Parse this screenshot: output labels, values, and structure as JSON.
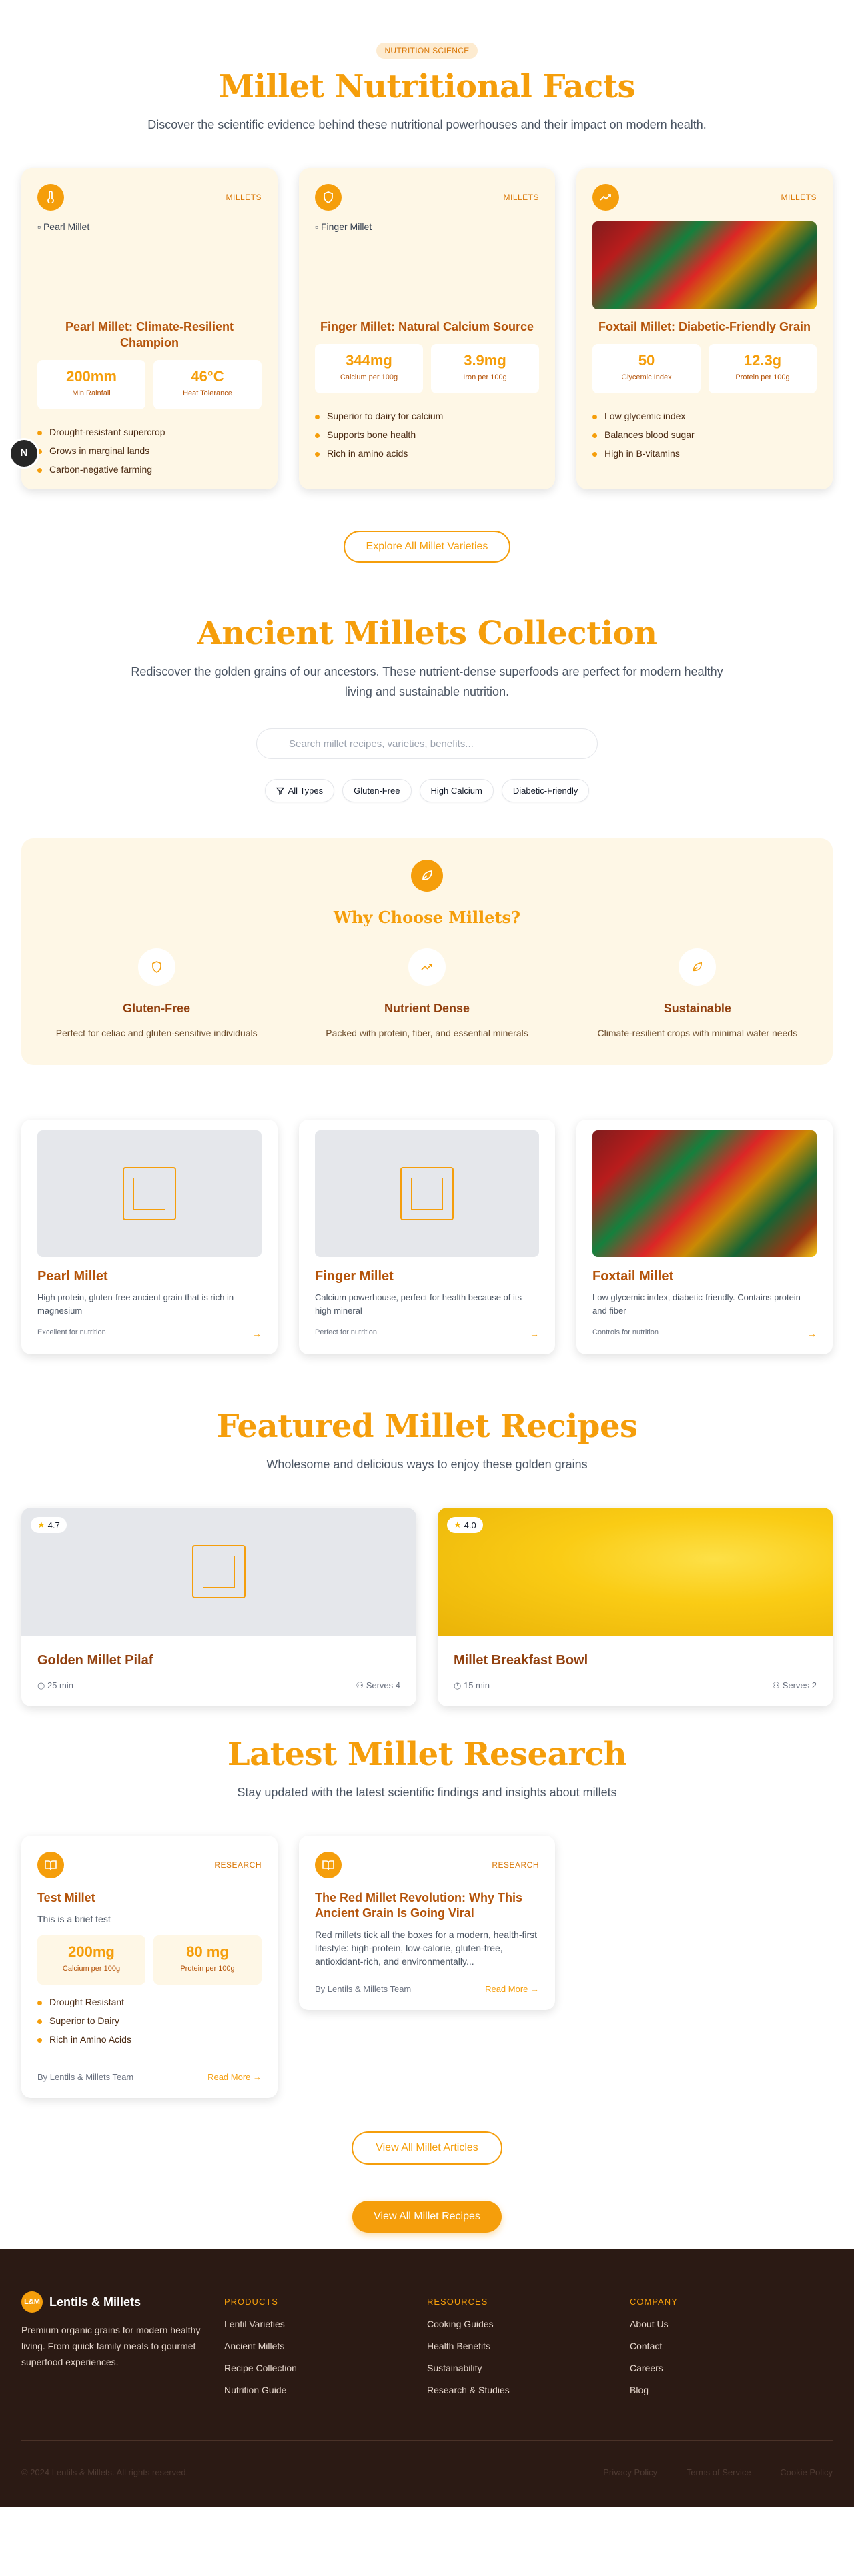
{
  "facts_section": {
    "badge": "NUTRITION SCIENCE",
    "title": "Millet Nutritional Facts",
    "subtitle": "Discover the scientific evidence behind these nutritional powerhouses and their impact on modern health.",
    "cards": [
      {
        "icon": "thermometer-icon",
        "tag": "MILLETS",
        "image_alt": "Pearl Millet",
        "title": "Pearl Millet: Climate-Resilient Champion",
        "stats": [
          {
            "value": "200mm",
            "label": "Min Rainfall"
          },
          {
            "value": "46°C",
            "label": "Heat Tolerance"
          }
        ],
        "points": [
          "Drought-resistant supercrop",
          "Grows in marginal lands",
          "Carbon-negative farming"
        ]
      },
      {
        "icon": "shield-icon",
        "tag": "MILLETS",
        "image_alt": "Finger Millet",
        "title": "Finger Millet: Natural Calcium Source",
        "stats": [
          {
            "value": "344mg",
            "label": "Calcium per 100g"
          },
          {
            "value": "3.9mg",
            "label": "Iron per 100g"
          }
        ],
        "points": [
          "Superior to dairy for calcium",
          "Supports bone health",
          "Rich in amino acids"
        ]
      },
      {
        "icon": "trending-up-icon",
        "tag": "MILLETS",
        "image_alt": "Foxtail Millet",
        "title": "Foxtail Millet: Diabetic-Friendly Grain",
        "stats": [
          {
            "value": "50",
            "label": "Glycemic Index"
          },
          {
            "value": "12.3g",
            "label": "Protein per 100g"
          }
        ],
        "points": [
          "Low glycemic index",
          "Balances blood sugar",
          "High in B-vitamins"
        ]
      }
    ],
    "button": "Explore All Millet Varieties"
  },
  "avatar_letter": "N",
  "collection_section": {
    "title": "Ancient Millets Collection",
    "subtitle": "Rediscover the golden grains of our ancestors. These nutrient-dense superfoods are perfect for modern healthy living and sustainable nutrition.",
    "search_placeholder": "Search millet recipes, varieties, benefits...",
    "filters": [
      "All Types",
      "Gluten-Free",
      "High Calcium",
      "Diabetic-Friendly"
    ],
    "why": {
      "title": "Why Choose Millets?",
      "items": [
        {
          "icon": "shield-icon",
          "title": "Gluten-Free",
          "text": "Perfect for celiac and gluten-sensitive individuals"
        },
        {
          "icon": "trending-up-icon",
          "title": "Nutrient Dense",
          "text": "Packed with protein, fiber, and essential minerals"
        },
        {
          "icon": "leaf-icon",
          "title": "Sustainable",
          "text": "Climate-resilient crops with minimal water needs"
        }
      ]
    },
    "varieties": [
      {
        "name": "Pearl Millet",
        "desc": "High protein, gluten-free ancient grain that is rich in magnesium",
        "note": "Excellent for nutrition"
      },
      {
        "name": "Finger Millet",
        "desc": "Calcium powerhouse, perfect for health because of its high mineral",
        "note": "Perfect for nutrition"
      },
      {
        "name": "Foxtail Millet",
        "desc": "Low glycemic index, diabetic-friendly. Contains protein and fiber",
        "note": "Controls for nutrition"
      }
    ]
  },
  "recipes_section": {
    "title": "Featured Millet Recipes",
    "subtitle": "Wholesome and delicious ways to enjoy these golden grains",
    "recipes": [
      {
        "rating": "4.7",
        "name": "Golden Millet Pilaf",
        "time": "25 min",
        "serves": "Serves 4"
      },
      {
        "rating": "4.0",
        "name": "Millet Breakfast Bowl",
        "time": "15 min",
        "serves": "Serves 2"
      }
    ]
  },
  "research_section": {
    "title": "Latest Millet Research",
    "subtitle": "Stay updated with the latest scientific findings and insights about millets",
    "articles": [
      {
        "tag": "RESEARCH",
        "title": "Test Millet",
        "desc": "This is a brief test",
        "stats": [
          {
            "value": "200mg",
            "label": "Calcium per 100g"
          },
          {
            "value": "80 mg",
            "label": "Protein per 100g"
          }
        ],
        "points": [
          "Drought Resistant",
          "Superior to Dairy",
          "Rich in Amino Acids"
        ],
        "author": "By Lentils & Millets Team",
        "read_more": "Read More →"
      },
      {
        "tag": "RESEARCH",
        "title": "The Red Millet Revolution: Why This Ancient Grain Is Going Viral",
        "desc": "Red millets tick all the boxes for a modern, health-first lifestyle: high-protein, low-calorie, gluten-free, antioxidant-rich, and environmentally...",
        "author": "By Lentils & Millets Team",
        "read_more": "Read More →"
      }
    ],
    "button_articles": "View All Millet Articles",
    "button_recipes": "View All Millet Recipes"
  },
  "footer": {
    "logo_text": "L&M",
    "brand": "Lentils & Millets",
    "desc": "Premium organic grains for modern healthy living. From quick family meals to gourmet superfood experiences.",
    "columns": [
      {
        "title": "PRODUCTS",
        "links": [
          "Lentil Varieties",
          "Ancient Millets",
          "Recipe Collection",
          "Nutrition Guide"
        ]
      },
      {
        "title": "RESOURCES",
        "links": [
          "Cooking Guides",
          "Health Benefits",
          "Sustainability",
          "Research & Studies"
        ]
      },
      {
        "title": "COMPANY",
        "links": [
          "About Us",
          "Contact",
          "Careers",
          "Blog"
        ]
      }
    ],
    "copyright": "© 2024 Lentils & Millets. All rights reserved.",
    "legal": [
      "Privacy Policy",
      "Terms of Service",
      "Cookie Policy"
    ]
  },
  "colors": {
    "accent": "#f59e0b",
    "brown": "#92400e",
    "cream": "#fef7e6",
    "footer_bg": "#2b1a14"
  }
}
